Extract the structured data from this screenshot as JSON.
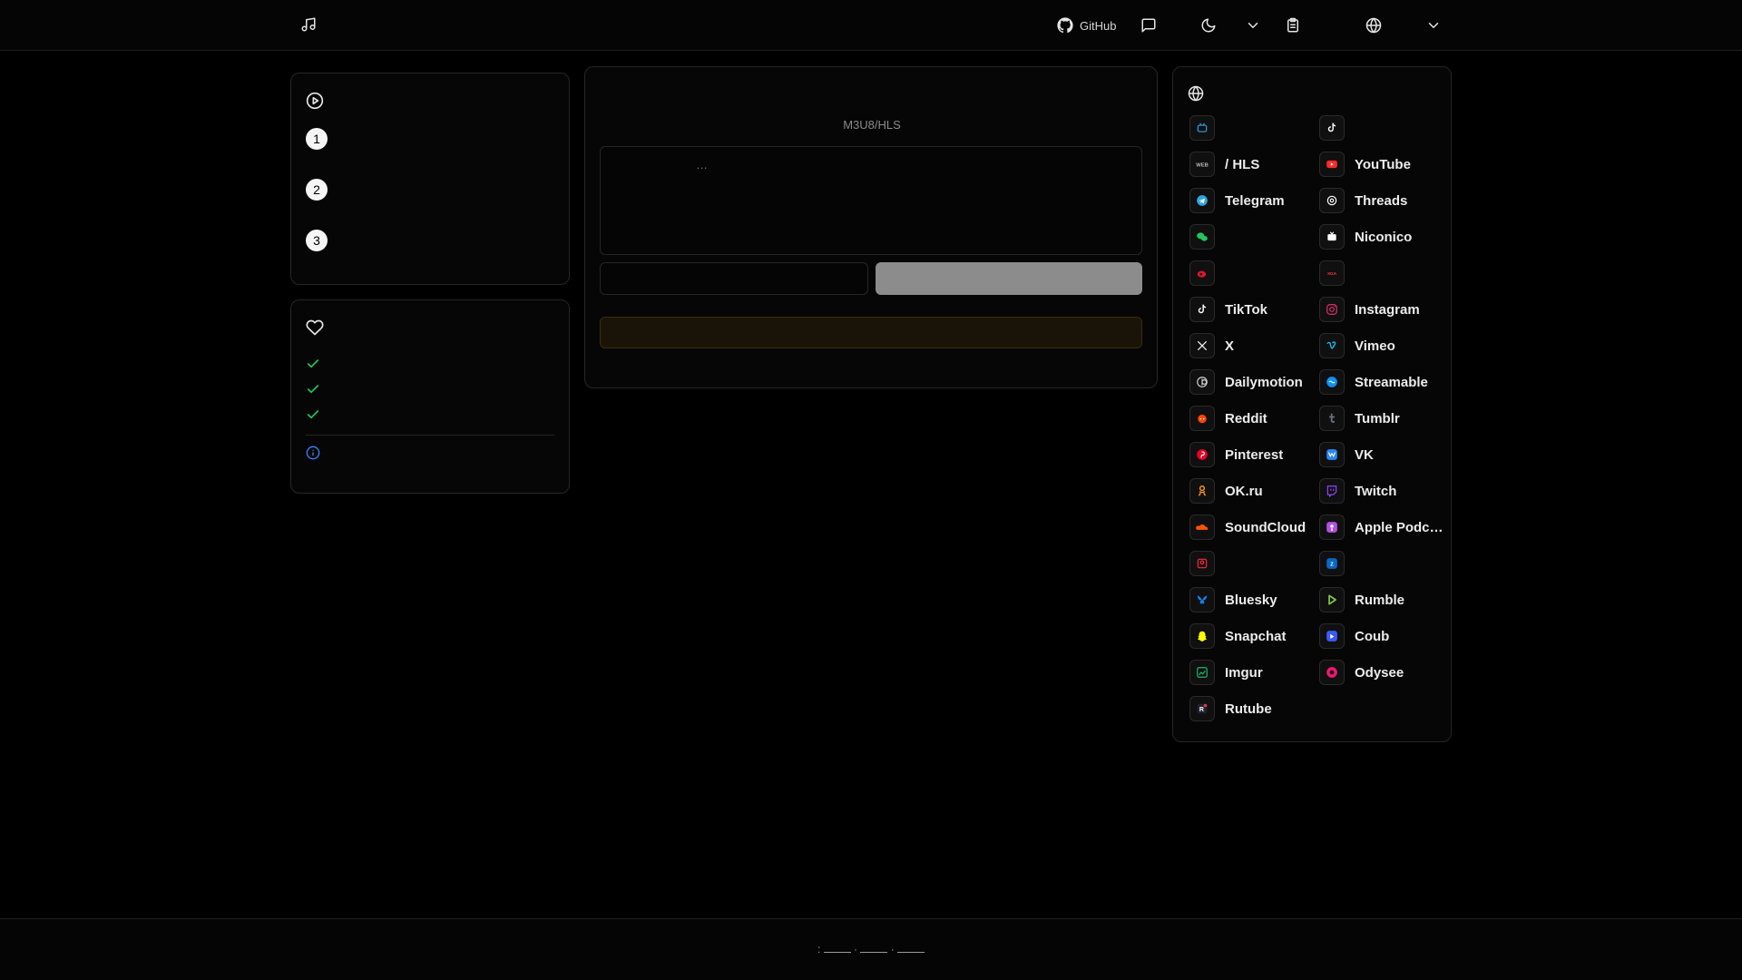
{
  "header": {
    "logo_icon": "music-note-icon",
    "github_label": "GitHub",
    "icons": [
      "github-icon",
      "message-square-icon",
      "moon-icon",
      "chevron-down-icon",
      "clipboard-list-icon",
      "globe-icon",
      "chevron-down-icon"
    ]
  },
  "steps": {
    "icon": "play-circle-icon",
    "title": "",
    "items": [
      {
        "number": "1",
        "text": ""
      },
      {
        "number": "2",
        "text": ""
      },
      {
        "number": "3",
        "text": ""
      }
    ]
  },
  "features": {
    "icon": "heart-icon",
    "title": "",
    "items": [
      "",
      "",
      ""
    ],
    "info_icon": "info-icon",
    "info_text": ""
  },
  "main": {
    "title": "",
    "subtitle": "M3U8/HLS",
    "url_placeholder": "…",
    "filename_placeholder": "",
    "download_label": "",
    "notice_text": ""
  },
  "platforms": {
    "icon": "globe-icon",
    "title": "",
    "items": [
      {
        "name": "",
        "icon": "bilibili-icon",
        "color": "#2ea0e0"
      },
      {
        "name": "",
        "icon": "douyin-icon",
        "color": "#ffffff"
      },
      {
        "name": "/ HLS",
        "icon": "web-icon",
        "color": "#bbbbbb"
      },
      {
        "name": "YouTube",
        "icon": "youtube-icon",
        "color": "#ff2a2a"
      },
      {
        "name": "Telegram",
        "icon": "telegram-icon",
        "color": "#2ea6e0"
      },
      {
        "name": "Threads",
        "icon": "threads-icon",
        "color": "#ffffff"
      },
      {
        "name": "",
        "icon": "wechat-icon",
        "color": "#22c55e"
      },
      {
        "name": "Niconico",
        "icon": "niconico-icon",
        "color": "#ffffff"
      },
      {
        "name": "",
        "icon": "weibo-icon",
        "color": "#e6162d"
      },
      {
        "name": "",
        "icon": "xigua-icon",
        "color": "#ff3b3b"
      },
      {
        "name": "TikTok",
        "icon": "tiktok-icon",
        "color": "#ffffff"
      },
      {
        "name": "Instagram",
        "icon": "instagram-icon",
        "color": "#e1306c"
      },
      {
        "name": "X",
        "icon": "x-icon",
        "color": "#ffffff"
      },
      {
        "name": "Vimeo",
        "icon": "vimeo-icon",
        "color": "#1ab7ea"
      },
      {
        "name": "Dailymotion",
        "icon": "dailymotion-icon",
        "color": "#cfcfcf"
      },
      {
        "name": "Streamable",
        "icon": "streamable-icon",
        "color": "#0f90fa"
      },
      {
        "name": "Reddit",
        "icon": "reddit-icon",
        "color": "#ff4500"
      },
      {
        "name": "Tumblr",
        "icon": "tumblr-icon",
        "color": "#6b7280"
      },
      {
        "name": "Pinterest",
        "icon": "pinterest-icon",
        "color": "#e60023"
      },
      {
        "name": "VK",
        "icon": "vk-icon",
        "color": "#2787f5"
      },
      {
        "name": "OK.ru",
        "icon": "okru-icon",
        "color": "#f7931e"
      },
      {
        "name": "Twitch",
        "icon": "twitch-icon",
        "color": "#9146ff"
      },
      {
        "name": "SoundCloud",
        "icon": "soundcloud-icon",
        "color": "#ff5500"
      },
      {
        "name": "Apple Podcasts",
        "icon": "apple-podcasts-icon",
        "color": "#b150e2"
      },
      {
        "name": "",
        "icon": "xiaohongshu-icon",
        "color": "#ff2442"
      },
      {
        "name": "",
        "icon": "zhihu-icon",
        "color": "#0a66c2"
      },
      {
        "name": "Bluesky",
        "icon": "bluesky-icon",
        "color": "#1185fe"
      },
      {
        "name": "Rumble",
        "icon": "rumble-icon",
        "color": "#85c742"
      },
      {
        "name": "Snapchat",
        "icon": "snapchat-icon",
        "color": "#fffc00"
      },
      {
        "name": "Coub",
        "icon": "coub-icon",
        "color": "#3b5bff"
      },
      {
        "name": "Imgur",
        "icon": "imgur-icon",
        "color": "#1bb76e"
      },
      {
        "name": "Odysee",
        "icon": "odysee-icon",
        "color": "#ef1970"
      },
      {
        "name": "Rutube",
        "icon": "rutube-icon",
        "color": "#ff2d55"
      }
    ]
  },
  "footer": {
    "text": ":",
    "links": [
      "",
      "",
      ""
    ],
    "separators": [
      "·",
      "·"
    ]
  }
}
